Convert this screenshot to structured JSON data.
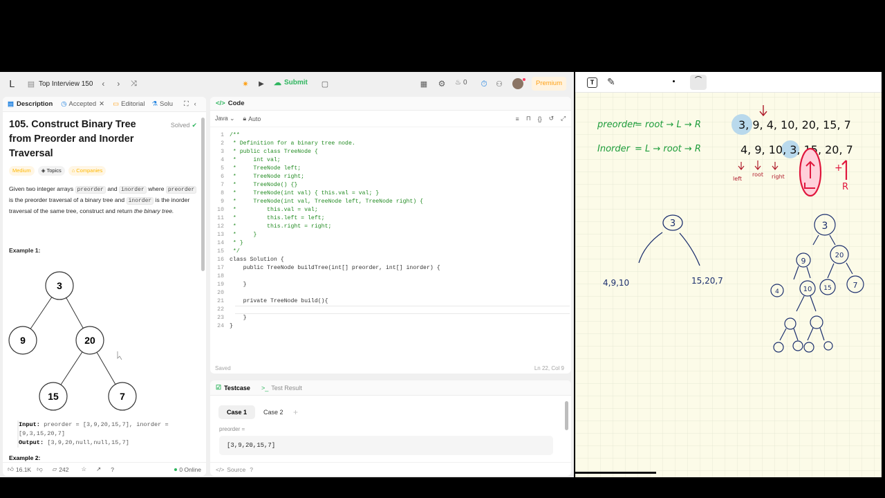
{
  "topbar": {
    "list_title": "Top Interview 150",
    "submit_label": "Submit",
    "streak_count": "0",
    "premium_label": "Premium"
  },
  "left_tabs": {
    "description": "Description",
    "accepted": "Accepted",
    "editorial": "Editorial",
    "solutions": "Solu"
  },
  "problem": {
    "title": "105. Construct Binary Tree from Preorder and Inorder Traversal",
    "status": "Solved",
    "difficulty": "Medium",
    "topics": "Topics",
    "companies": "Companies",
    "desc_1": "Given two integer arrays",
    "preorder": "preorder",
    "and": "and",
    "inorder": "inorder",
    "where": "where",
    "desc_2": "is the preorder traversal of a binary tree and",
    "desc_3": "is the inorder traversal of the same tree, construct and return",
    "desc_4": "the binary tree.",
    "example1_label": "Example 1:",
    "tree_nodes": [
      "3",
      "9",
      "20",
      "15",
      "7"
    ],
    "input_label": "Input:",
    "input_value": "preorder = [3,9,20,15,7], inorder = [9,3,15,20,7]",
    "output_label": "Output:",
    "output_value": "[3,9,20,null,null,15,7]",
    "example2_label": "Example 2:"
  },
  "left_footer": {
    "likes": "16.1K",
    "comments": "242",
    "online": "0 Online"
  },
  "code": {
    "header": "Code",
    "language": "Java",
    "mode": "Auto",
    "status": "Saved",
    "cursor": "Ln 22, Col 9",
    "lines": [
      {
        "n": "1",
        "t": "/**",
        "c": "cm"
      },
      {
        "n": "2",
        "t": " * Definition for a binary tree node.",
        "c": "cm"
      },
      {
        "n": "3",
        "t": " * public class TreeNode {",
        "c": "cm"
      },
      {
        "n": "4",
        "t": " *     int val;",
        "c": "cm"
      },
      {
        "n": "5",
        "t": " *     TreeNode left;",
        "c": "cm"
      },
      {
        "n": "6",
        "t": " *     TreeNode right;",
        "c": "cm"
      },
      {
        "n": "7",
        "t": " *     TreeNode() {}",
        "c": "cm"
      },
      {
        "n": "8",
        "t": " *     TreeNode(int val) { this.val = val; }",
        "c": "cm"
      },
      {
        "n": "9",
        "t": " *     TreeNode(int val, TreeNode left, TreeNode right) {",
        "c": "cm"
      },
      {
        "n": "10",
        "t": " *         this.val = val;",
        "c": "cm"
      },
      {
        "n": "11",
        "t": " *         this.left = left;",
        "c": "cm"
      },
      {
        "n": "12",
        "t": " *         this.right = right;",
        "c": "cm"
      },
      {
        "n": "13",
        "t": " *     }",
        "c": "cm"
      },
      {
        "n": "14",
        "t": " * }",
        "c": "cm"
      },
      {
        "n": "15",
        "t": " */",
        "c": "cm"
      },
      {
        "n": "16",
        "t": "class Solution {",
        "c": "tx"
      },
      {
        "n": "17",
        "t": "    public TreeNode buildTree(int[] preorder, int[] inorder) {",
        "c": "tx"
      },
      {
        "n": "18",
        "t": "",
        "c": "tx"
      },
      {
        "n": "19",
        "t": "    }",
        "c": "tx"
      },
      {
        "n": "20",
        "t": "",
        "c": "tx"
      },
      {
        "n": "21",
        "t": "    private TreeNode build(){",
        "c": "tx"
      },
      {
        "n": "22",
        "t": "",
        "c": "tx"
      },
      {
        "n": "23",
        "t": "    }",
        "c": "tx"
      },
      {
        "n": "24",
        "t": "}",
        "c": "tx"
      }
    ]
  },
  "testpane": {
    "testcase_tab": "Testcase",
    "result_tab": "Test Result",
    "case1": "Case 1",
    "case2": "Case 2",
    "param_label": "preorder =",
    "param_value": "[3,9,20,15,7]",
    "source": "Source"
  },
  "whiteboard": {
    "preorder_label": "preorder",
    "preorder_formula": "= root → L → R",
    "preorder_values": "3, 9, 4, 10, 20, 15, 7",
    "inorder_label": "Inorder",
    "inorder_formula": "= L → root → R",
    "inorder_values": "4, 9, 10, 3, 15, 20, 7",
    "left_note": "left",
    "root_note": "root",
    "right_note": "right",
    "plus_note": "+",
    "r_note": "R",
    "mid_root": "3",
    "mid_left": "4,9,10",
    "mid_right": "15,20,7",
    "tree_root": "3",
    "tree_l": "9",
    "tree_r": "20",
    "tree_ll": "4",
    "tree_lr": "10",
    "tree_rl": "15",
    "tree_rr": "7"
  },
  "colors": {
    "accent_green": "#2db55d",
    "premium_orange": "#ffa116",
    "board_bg": "#fcfbe8",
    "ink_green": "#1d9c3a",
    "ink_blue": "#1c2f6e",
    "ink_red": "#d21f3c"
  }
}
